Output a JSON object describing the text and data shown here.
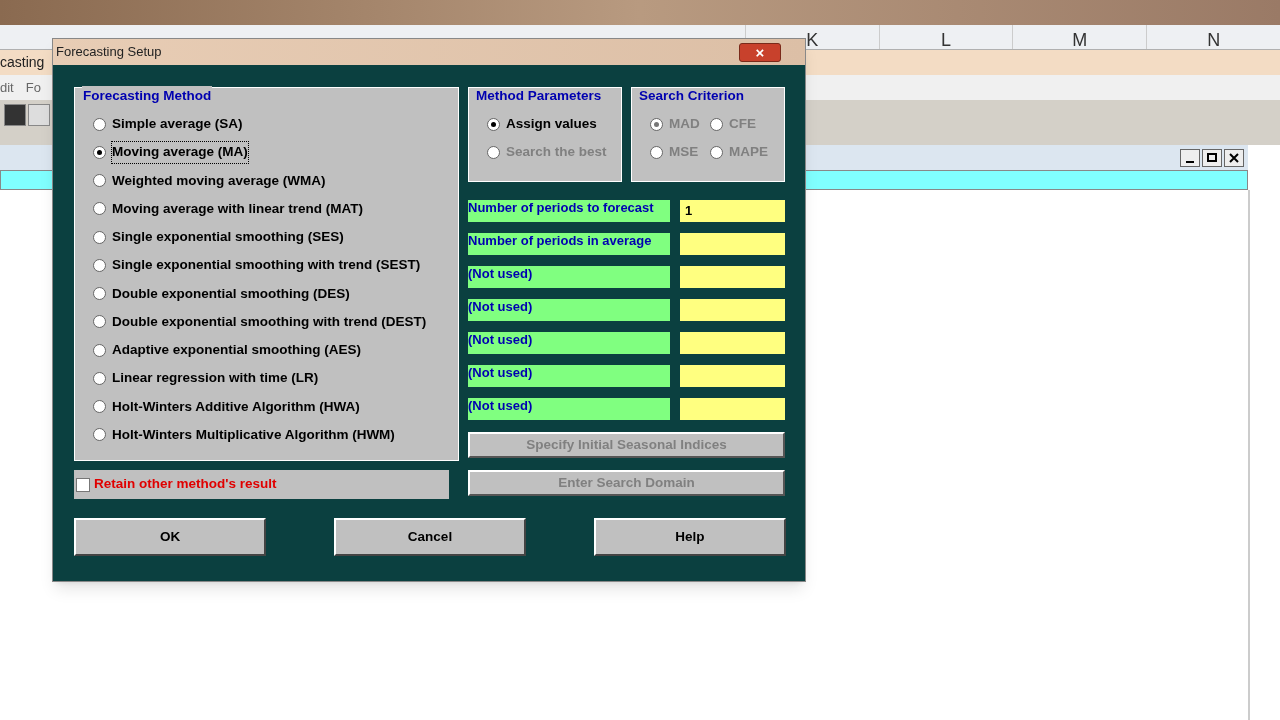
{
  "background": {
    "columns": [
      "K",
      "L",
      "M",
      "N"
    ],
    "window_title": "casting",
    "menu": [
      "dit",
      "Fo"
    ]
  },
  "dialog": {
    "title": "Forecasting Setup",
    "close": "×",
    "forecasting_method": {
      "title": "Forecasting Method",
      "options": [
        {
          "label": "Simple average (SA)",
          "selected": false
        },
        {
          "label": "Moving average (MA)",
          "selected": true
        },
        {
          "label": "Weighted moving average (WMA)",
          "selected": false
        },
        {
          "label": "Moving average with linear trend (MAT)",
          "selected": false
        },
        {
          "label": "Single exponential smoothing (SES)",
          "selected": false
        },
        {
          "label": "Single exponential smoothing with trend (SEST)",
          "selected": false
        },
        {
          "label": "Double exponential smoothing (DES)",
          "selected": false
        },
        {
          "label": "Double exponential smoothing with trend (DEST)",
          "selected": false
        },
        {
          "label": "Adaptive exponential smoothing (AES)",
          "selected": false
        },
        {
          "label": "Linear regression with time (LR)",
          "selected": false
        },
        {
          "label": "Holt-Winters Additive Algorithm (HWA)",
          "selected": false
        },
        {
          "label": "Holt-Winters Multiplicative Algorithm (HWM)",
          "selected": false
        }
      ]
    },
    "method_parameters": {
      "title": "Method Parameters",
      "options": [
        {
          "label": "Assign values",
          "selected": true,
          "disabled": false
        },
        {
          "label": "Search the best",
          "selected": false,
          "disabled": true
        }
      ]
    },
    "search_criterion": {
      "title": "Search Criterion",
      "options": [
        {
          "label": "MAD",
          "selected": true,
          "disabled": true
        },
        {
          "label": "CFE",
          "selected": false,
          "disabled": true
        },
        {
          "label": "MSE",
          "selected": false,
          "disabled": true
        },
        {
          "label": "MAPE",
          "selected": false,
          "disabled": true
        }
      ]
    },
    "parameters": [
      {
        "label": "Number of periods to forecast",
        "value": "1"
      },
      {
        "label": "Number of periods in average"
      },
      {
        "label": "(Not used)"
      },
      {
        "label": "(Not used)"
      },
      {
        "label": "(Not used)"
      },
      {
        "label": "(Not used)"
      },
      {
        "label": "(Not used)"
      }
    ],
    "side_buttons": [
      {
        "label": "Specify Initial Seasonal Indices",
        "disabled": true
      },
      {
        "label": "Enter Search Domain",
        "disabled": true
      }
    ],
    "retain": {
      "label": "Retain other method's result",
      "checked": false
    },
    "buttons": [
      "OK",
      "Cancel",
      "Help"
    ]
  }
}
